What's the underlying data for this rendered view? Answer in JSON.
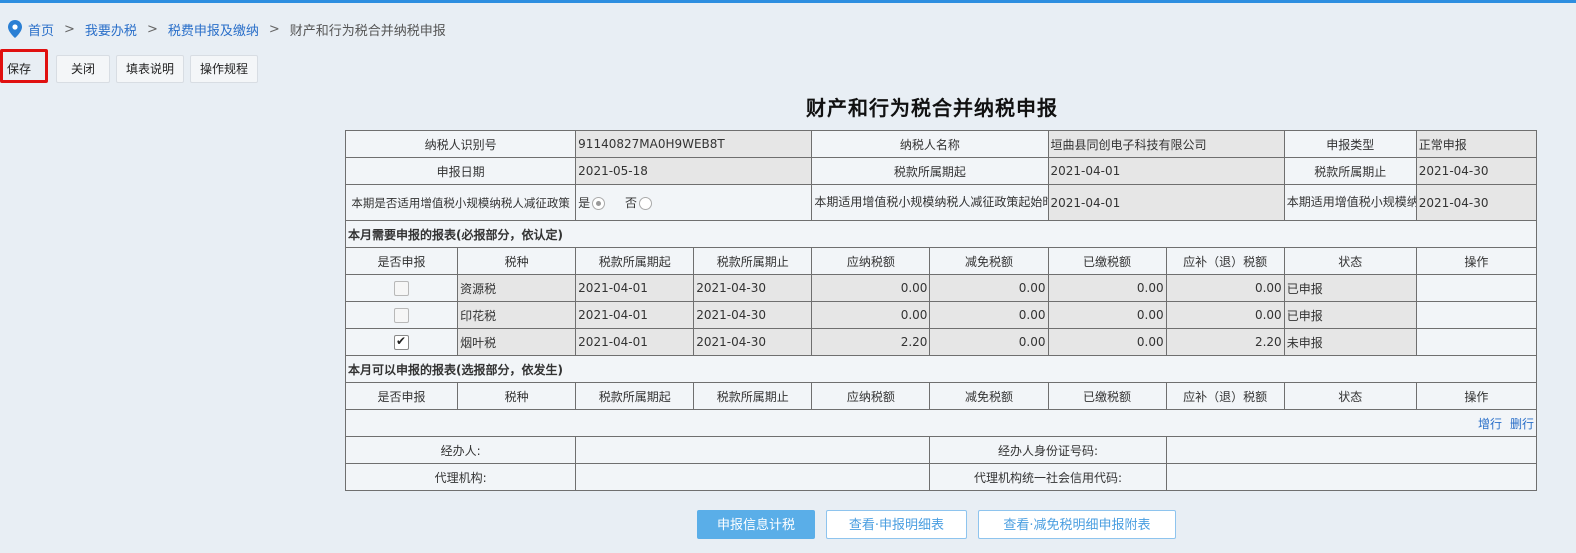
{
  "breadcrumb": {
    "items": [
      "首页",
      "我要办税",
      "税费申报及缴纳"
    ],
    "current": "财产和行为税合并纳税申报",
    "separator": ">"
  },
  "toolbar": {
    "save": "保存",
    "close": "关闭",
    "fill_help": "填表说明",
    "op_rules": "操作规程"
  },
  "form": {
    "title": "财产和行为税合并纳税申报",
    "taxpayer_id_label": "纳税人识别号",
    "taxpayer_id": "91140827MA0H9WEB8T",
    "taxpayer_name_label": "纳税人名称",
    "taxpayer_name": "垣曲县同创电子科技有限公司",
    "decl_type_label": "申报类型",
    "decl_type": "正常申报",
    "decl_date_label": "申报日期",
    "decl_date": "2021-05-18",
    "period_start_label": "税款所属期起",
    "period_start": "2021-04-01",
    "period_end_label": "税款所属期止",
    "period_end": "2021-04-30",
    "policy_label": "本期是否适用增值税小规模纳税人减征政策",
    "yes": "是",
    "no": "否",
    "policy_start_label": "本期适用增值税小规模纳税人减征政策起始时间",
    "policy_start": "2021-04-01",
    "policy_end_label": "本期适用增值税小规模纳税人减征政策终止时间",
    "policy_end": "2021-04-30"
  },
  "section_required": "本月需要申报的报表(必报部分，依认定)",
  "section_optional": "本月可以申报的报表(选报部分，依发生)",
  "columns": [
    "是否申报",
    "税种",
    "税款所属期起",
    "税款所属期止",
    "应纳税额",
    "减免税额",
    "已缴税额",
    "应补（退）税额",
    "状态",
    "操作"
  ],
  "rows": [
    {
      "tax": "资源税",
      "start": "2021-04-01",
      "end": "2021-04-30",
      "payable": "0.00",
      "relief": "0.00",
      "paid": "0.00",
      "due": "0.00",
      "status": "已申报",
      "checked": false
    },
    {
      "tax": "印花税",
      "start": "2021-04-01",
      "end": "2021-04-30",
      "payable": "0.00",
      "relief": "0.00",
      "paid": "0.00",
      "due": "0.00",
      "status": "已申报",
      "checked": false
    },
    {
      "tax": "烟叶税",
      "start": "2021-04-01",
      "end": "2021-04-30",
      "payable": "2.20",
      "relief": "0.00",
      "paid": "0.00",
      "due": "2.20",
      "status": "未申报",
      "checked": true
    }
  ],
  "row_actions": {
    "add": "增行",
    "delete": "删行"
  },
  "agent": {
    "handler_label": "经办人:",
    "handler_id_label": "经办人身份证号码:",
    "agency_label": "代理机构:",
    "agency_code_label": "代理机构统一社会信用代码:"
  },
  "bottom_buttons": {
    "calc": "申报信息计税",
    "view_detail": "查看·申报明细表",
    "view_relief": "查看·减免税明细申报附表"
  }
}
